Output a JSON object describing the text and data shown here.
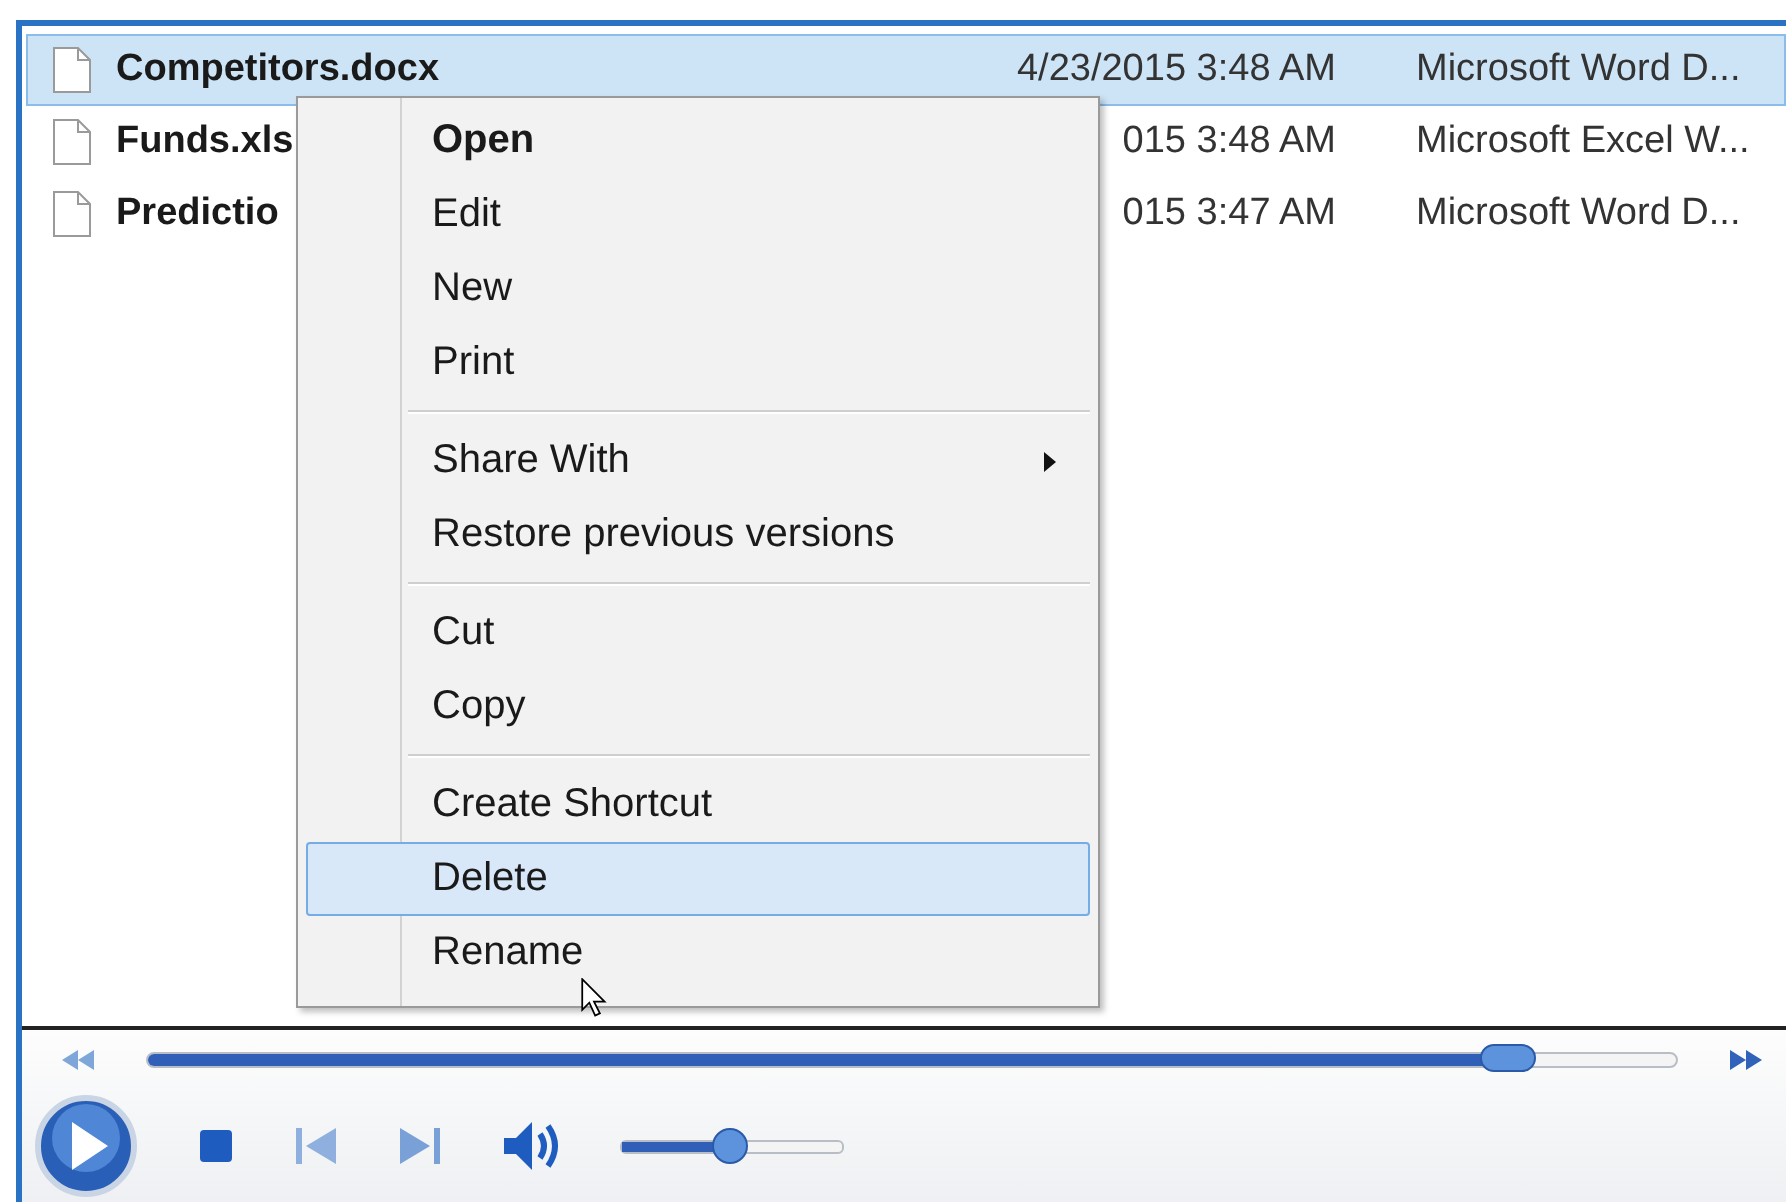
{
  "files": [
    {
      "name": "Competitors.docx",
      "date": "4/23/2015 3:48 AM",
      "type": "Microsoft Word D...",
      "selected": true
    },
    {
      "name": "Funds.xls",
      "date": "015 3:48 AM",
      "type": "Microsoft Excel W...",
      "selected": false
    },
    {
      "name": "Predictio",
      "date": "015 3:47 AM",
      "type": "Microsoft Word D...",
      "selected": false
    }
  ],
  "context_menu": {
    "items": [
      {
        "kind": "item",
        "label": "Open",
        "bold": true,
        "submenu": false,
        "selected": false
      },
      {
        "kind": "item",
        "label": "Edit",
        "bold": false,
        "submenu": false,
        "selected": false
      },
      {
        "kind": "item",
        "label": "New",
        "bold": false,
        "submenu": false,
        "selected": false
      },
      {
        "kind": "item",
        "label": "Print",
        "bold": false,
        "submenu": false,
        "selected": false
      },
      {
        "kind": "separator"
      },
      {
        "kind": "item",
        "label": "Share With",
        "bold": false,
        "submenu": true,
        "selected": false
      },
      {
        "kind": "item",
        "label": "Restore previous versions",
        "bold": false,
        "submenu": false,
        "selected": false
      },
      {
        "kind": "separator"
      },
      {
        "kind": "item",
        "label": "Cut",
        "bold": false,
        "submenu": false,
        "selected": false
      },
      {
        "kind": "item",
        "label": "Copy",
        "bold": false,
        "submenu": false,
        "selected": false
      },
      {
        "kind": "separator"
      },
      {
        "kind": "item",
        "label": "Create Shortcut",
        "bold": false,
        "submenu": false,
        "selected": false
      },
      {
        "kind": "item",
        "label": "Delete",
        "bold": false,
        "submenu": false,
        "selected": true
      },
      {
        "kind": "item",
        "label": "Rename",
        "bold": false,
        "submenu": false,
        "selected": false
      }
    ]
  },
  "player": {
    "seek": {
      "level": 0.89
    },
    "volume": {
      "level": 0.49
    }
  }
}
